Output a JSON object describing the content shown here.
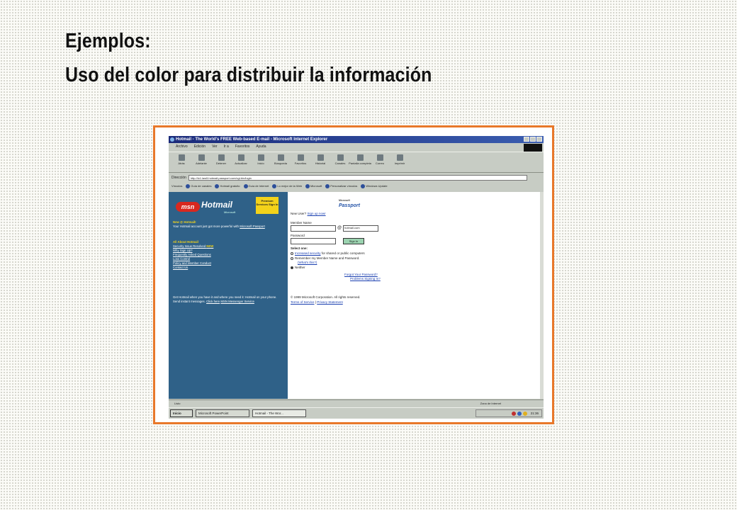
{
  "slide": {
    "title_line1": "Ejemplos:",
    "title_line2": "Uso del color para distribuir la información"
  },
  "colors": {
    "frame_border": "#e8782a",
    "left_panel": "#2f6188",
    "accent_yellow": "#f3d21a",
    "msn_red": "#d8281f"
  },
  "browser": {
    "window_title": "Hotmail - The World's FREE Web-based E-mail - Microsoft Internet Explorer",
    "menu": [
      "Archivo",
      "Edición",
      "Ver",
      "Ir a",
      "Favoritos",
      "Ayuda"
    ],
    "toolbar": [
      {
        "label": "Atrás",
        "icon": "back-icon"
      },
      {
        "label": "Adelante",
        "icon": "forward-icon"
      },
      {
        "label": "Detener",
        "icon": "stop-icon"
      },
      {
        "label": "Actualizar",
        "icon": "refresh-icon"
      },
      {
        "label": "Inicio",
        "icon": "home-icon"
      },
      {
        "label": "Búsqueda",
        "icon": "search-icon"
      },
      {
        "label": "Favoritos",
        "icon": "favorites-icon"
      },
      {
        "label": "Historial",
        "icon": "history-icon"
      },
      {
        "label": "Canales",
        "icon": "channels-icon"
      },
      {
        "label": "Pantalla completa",
        "icon": "fullscreen-icon"
      },
      {
        "label": "Correo",
        "icon": "mail-icon"
      },
      {
        "label": "Imprimir",
        "icon": "print-icon"
      }
    ],
    "address_label": "Dirección",
    "address_value": "http://lc1.law5.hotmail.passport.com/cgi-bin/login",
    "links_label": "Vínculos",
    "links": [
      "Guía de canales",
      "Hotmail gratuito",
      "Guía de Internet",
      "Lo mejor de la Web",
      "Microsoft",
      "Personalizar vínculos",
      "Windows Update"
    ]
  },
  "hotmail": {
    "msn": "msn",
    "logo": "Hotmail",
    "logo_sub": "Microsoft",
    "premium": "Premium Services Sign In",
    "new_head": "New @ Hotmail!",
    "new_text": "Your Hotmail account just got more powerful with",
    "new_link": "Microsoft Passport",
    "about_head": "All About Hotmail",
    "about_links": [
      "Security Issue Resolved",
      "Why Sign Up?",
      "Frequently Asked Questions",
      "Loss Control",
      "Policy and Member Conduct",
      "Contact Us"
    ],
    "about_new_badge": "NEW",
    "footer_text": "Get Hotmail when you have it and where you need it: Hotmail on your phone. Send instant messages.",
    "footer_link1": "Click here",
    "footer_link2": "MSN Messenger Service"
  },
  "signin": {
    "passport_top": "Microsoft",
    "passport": "Passport",
    "new_user": "New User?",
    "signup_link": "Sign up now!",
    "member_label": "Member Name",
    "domain_value": "hotmail.com",
    "password_label": "Password",
    "signin_button": "Sign In",
    "select_label": "Select one:",
    "option1_link": "Increased security",
    "option1_text": "for shared or public computers",
    "option2_text": "Remember my Member Name and Password.",
    "option2_link": "(What's this?)",
    "option3_text": "Neither",
    "forgot_link": "Forgot Your Password?",
    "problems_link": "Problems Signing In?",
    "copyright": "© 1999 Microsoft Corporation. All rights reserved.",
    "terms_link": "Terms of Service",
    "privacy_link": "Privacy Statement"
  },
  "status": {
    "left": "Listo",
    "zone": "Zona de Internet"
  },
  "taskbar": {
    "start": "Inicio",
    "items": [
      "Microsoft PowerPoint",
      "Hotmail - The Wor..."
    ],
    "clock": "21:36"
  }
}
